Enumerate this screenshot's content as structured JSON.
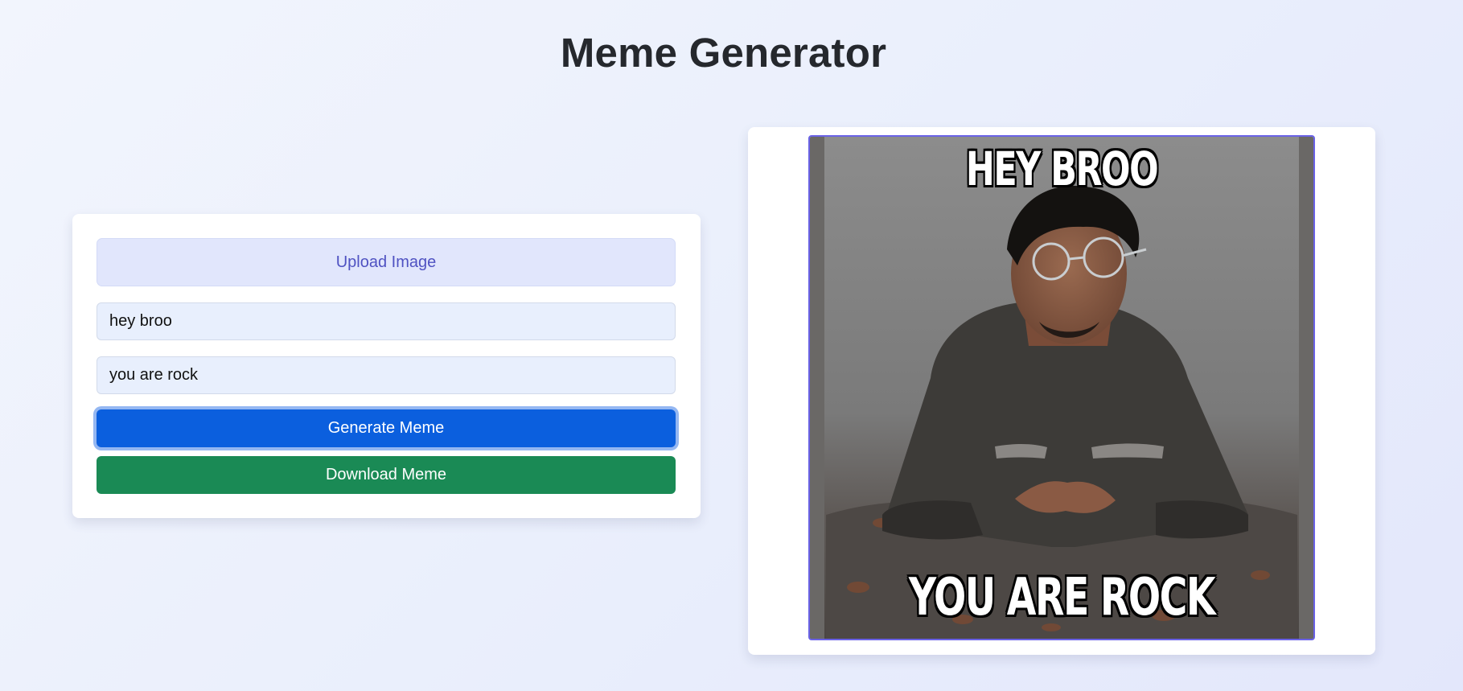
{
  "header": {
    "title": "Meme Generator"
  },
  "controls": {
    "upload_label": "Upload Image",
    "top_text_value": "hey broo",
    "bottom_text_value": "you are rock",
    "generate_label": "Generate Meme",
    "download_label": "Download Meme"
  },
  "preview": {
    "top_text": "HEY BROO",
    "bottom_text": "YOU ARE ROCK"
  },
  "colors": {
    "accent": "#0b5fde",
    "download": "#1a8a55",
    "upload_text": "#4f52c2",
    "frame_border": "#6a62e6"
  },
  "icons": {
    "upload": "upload-icon"
  }
}
